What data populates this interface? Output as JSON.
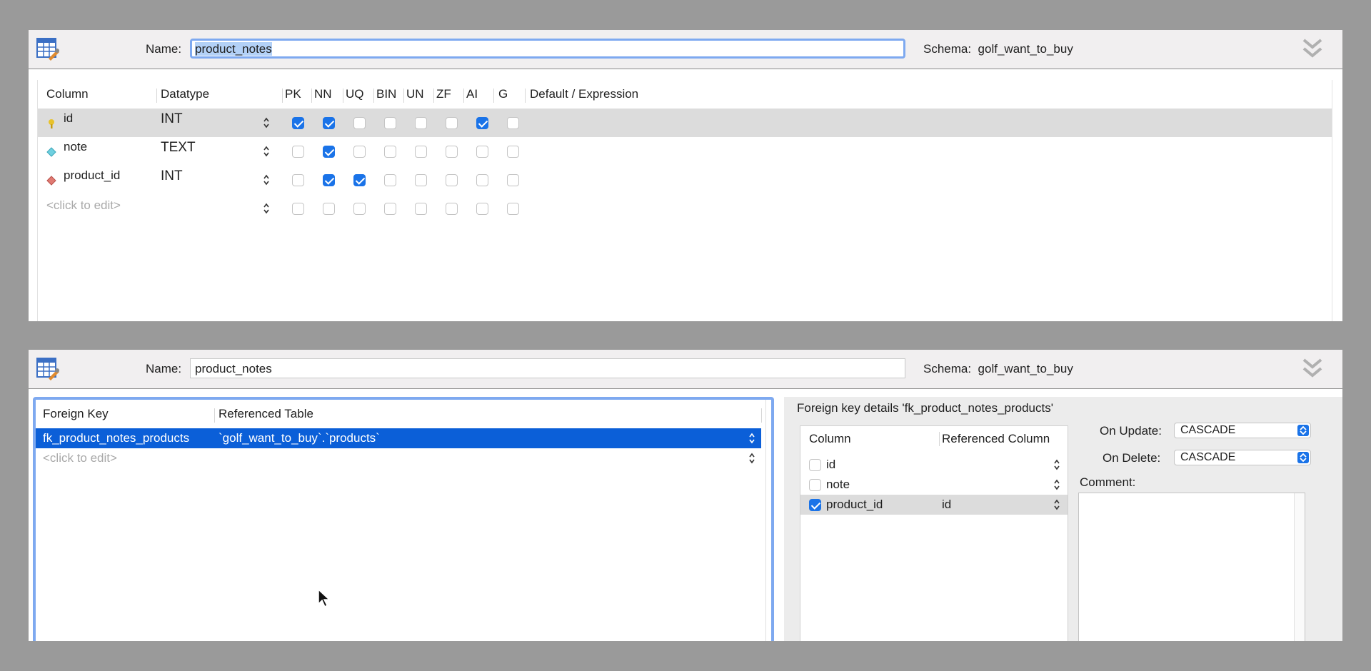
{
  "top_editor": {
    "name_label": "Name:",
    "name_value": "product_notes",
    "schema_label": "Schema:",
    "schema_value": "golf_want_to_buy",
    "icons": {
      "table": "table-editor-icon",
      "collapse": "chevron-double-down-icon"
    },
    "columns_headers": [
      "Column",
      "Datatype",
      "PK",
      "NN",
      "UQ",
      "BIN",
      "UN",
      "ZF",
      "AI",
      "G",
      "Default / Expression"
    ],
    "rows": [
      {
        "name": "id",
        "datatype": "INT",
        "icon": "primary-key-icon",
        "flags": [
          true,
          true,
          false,
          false,
          false,
          false,
          true,
          false
        ],
        "selected": true
      },
      {
        "name": "note",
        "datatype": "TEXT",
        "icon": "column-icon",
        "flags": [
          false,
          true,
          false,
          false,
          false,
          false,
          false,
          false
        ],
        "selected": false
      },
      {
        "name": "product_id",
        "datatype": "INT",
        "icon": "foreign-key-column-icon",
        "flags": [
          false,
          true,
          true,
          false,
          false,
          false,
          false,
          false
        ],
        "selected": false
      }
    ],
    "placeholder": "<click to edit>"
  },
  "bottom_editor": {
    "name_label": "Name:",
    "name_value": "product_notes",
    "schema_label": "Schema:",
    "schema_value": "golf_want_to_buy",
    "fk_headers": [
      "Foreign Key",
      "Referenced Table"
    ],
    "fk_rows": [
      {
        "name": "fk_product_notes_products",
        "ref_table": "`golf_want_to_buy`.`products`"
      }
    ],
    "placeholder": "<click to edit>",
    "details_title": "Foreign key details 'fk_product_notes_products'",
    "details_headers": [
      "Column",
      "Referenced Column"
    ],
    "details_rows": [
      {
        "column": "id",
        "checked": false,
        "ref": ""
      },
      {
        "column": "note",
        "checked": false,
        "ref": ""
      },
      {
        "column": "product_id",
        "checked": true,
        "ref": "id"
      }
    ],
    "on_update_label": "On Update:",
    "on_update_value": "CASCADE",
    "on_delete_label": "On Delete:",
    "on_delete_value": "CASCADE",
    "comment_label": "Comment:"
  },
  "colors": {
    "accent": "#1a73e8",
    "focus": "#7ea9f0",
    "selection": "#0b5fd8",
    "background": "#9a9a9a"
  }
}
